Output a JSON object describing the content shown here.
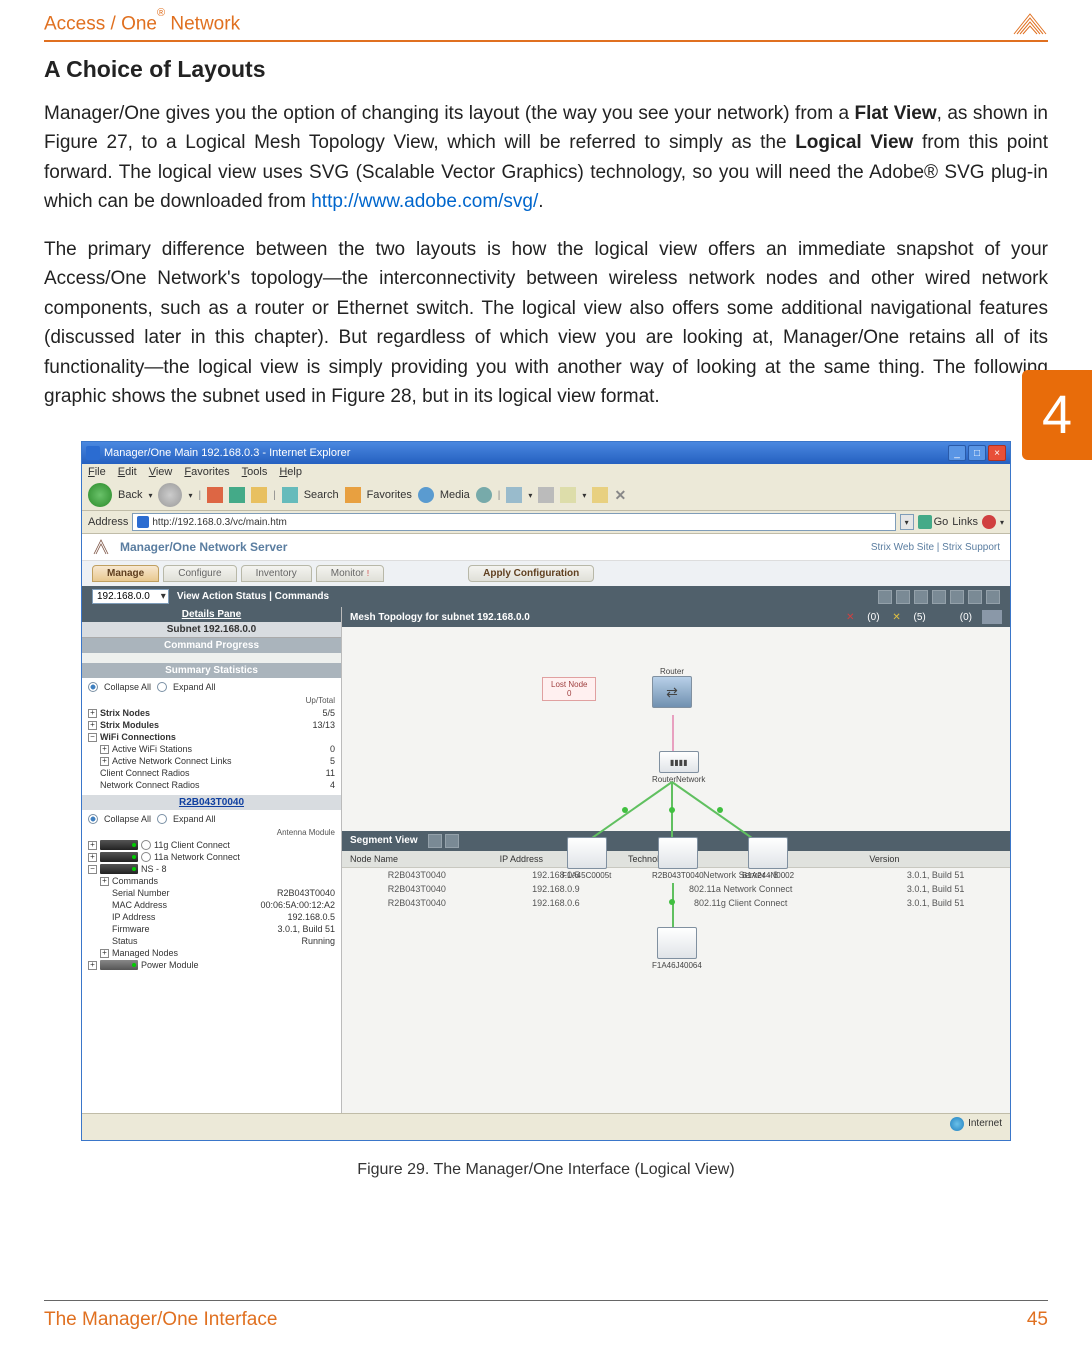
{
  "header": {
    "title_prefix": "Access / One",
    "title_suffix": " Network"
  },
  "tab_number": "4",
  "section_title": "A Choice of Layouts",
  "para1": {
    "t1": "Manager/One gives you the option of changing its layout (the way you see your network) from a ",
    "b1": "Flat View",
    "t2": ", as shown in Figure 27, to a Logical Mesh Topology View, which will be referred to simply as the ",
    "b2": "Logical View",
    "t3": " from this point forward. The logical view uses SVG (Scalable Vector Graphics) technology, so you will need the Adobe® SVG plug-in which can be downloaded from ",
    "link": "http://www.adobe.com/svg/",
    "t4": "."
  },
  "para2": "The primary difference between the two layouts is how the logical view offers an immediate snapshot of your Access/One Network's topology—the interconnectivity between wireless network nodes and other wired network components, such as a router or Ethernet switch. The logical view also offers some additional navigational features (discussed later in this chapter). But regardless of which view you are looking at, Manager/One retains all of its functionality—the logical view is simply providing you with another way of looking at the same thing. The following graphic shows the subnet used in Figure 28, but in its logical view format.",
  "app": {
    "window_title": "Manager/One Main 192.168.0.3 - Internet Explorer",
    "menu": [
      "File",
      "Edit",
      "View",
      "Favorites",
      "Tools",
      "Help"
    ],
    "toolbar": {
      "back": "Back",
      "search": "Search",
      "favorites": "Favorites",
      "media": "Media"
    },
    "address_label": "Address",
    "address_value": "http://192.168.0.3/vc/main.htm",
    "go": "Go",
    "links": "Links",
    "mgr_title": "Manager/One Network Server",
    "mgr_links": "Strix Web Site  |  Strix Support",
    "tabs": {
      "manage": "Manage",
      "configure": "Configure",
      "inventory": "Inventory",
      "monitor": "Monitor"
    },
    "apply": "Apply Configuration",
    "subbar_ip": "192.168.0.0",
    "subbar_text": "View Action Status  |  Commands",
    "details_pane": "Details Pane",
    "subnet": "Subnet 192.168.0.0",
    "cmd_progress": "Command Progress",
    "summary": "Summary Statistics",
    "collapse": "Collapse All",
    "expand": "Expand All",
    "uptotal": "Up/Total",
    "stats": [
      {
        "label": "Strix Nodes",
        "value": "5/5"
      },
      {
        "label": "Strix Modules",
        "value": "13/13"
      }
    ],
    "wifi_conn": "WiFi Connections",
    "wifi_rows": [
      {
        "label": "Active WiFi Stations",
        "value": "0"
      },
      {
        "label": "Active Network Connect Links",
        "value": "5"
      },
      {
        "label": "Client Connect Radios",
        "value": "11"
      },
      {
        "label": "Network Connect Radios",
        "value": "4"
      }
    ],
    "node_name": "R2B043T0040",
    "antenna_module": "Antenna Module",
    "mod_rows": [
      "11g Client Connect",
      "11a Network Connect",
      "NS - 8"
    ],
    "commands": "Commands",
    "detail_rows": [
      {
        "label": "Serial Number",
        "value": "R2B043T0040"
      },
      {
        "label": "MAC Address",
        "value": "00:06:5A:00:12:A2"
      },
      {
        "label": "IP Address",
        "value": "192.168.0.5"
      },
      {
        "label": "Firmware",
        "value": "3.0.1, Build 51"
      },
      {
        "label": "Status",
        "value": "Running"
      }
    ],
    "managed_nodes": "Managed Nodes",
    "power_module": "Power Module",
    "mesh_title": "Mesh Topology for subnet 192.168.0.0",
    "legend": [
      {
        "icon": "X",
        "color": "#d04040",
        "val": "(0)"
      },
      {
        "icon": "X",
        "color": "#e0c040",
        "val": "(5)"
      },
      {
        "icon": "",
        "color": "",
        "val": "(0)"
      }
    ],
    "lost_node": "Lost Node",
    "router": "Router",
    "router_network": "RouterNetwork",
    "topo_labels": [
      "F1A45C0005t",
      "R2B043T0040",
      "B1A244N0002",
      "F1A46J40064"
    ],
    "segment_view": "Segment View",
    "seg_cols": [
      "Node Name",
      "IP Address",
      "Technology",
      "Version"
    ],
    "seg_rows": [
      {
        "name": "R2B043T0040",
        "ip": "192.168.0.5",
        "tech": "Network Server - 8",
        "ver": "3.0.1, Build 51"
      },
      {
        "name": "R2B043T0040",
        "ip": "192.168.0.9",
        "tech": "802.11a Network Connect",
        "ver": "3.0.1, Build 51"
      },
      {
        "name": "R2B043T0040",
        "ip": "192.168.0.6",
        "tech": "802.11g Client Connect",
        "ver": "3.0.1, Build 51"
      }
    ],
    "status_internet": "Internet"
  },
  "figure_caption": "Figure 29. The Manager/One Interface (Logical View)",
  "footer": {
    "left": "The Manager/One Interface",
    "right": "45"
  }
}
